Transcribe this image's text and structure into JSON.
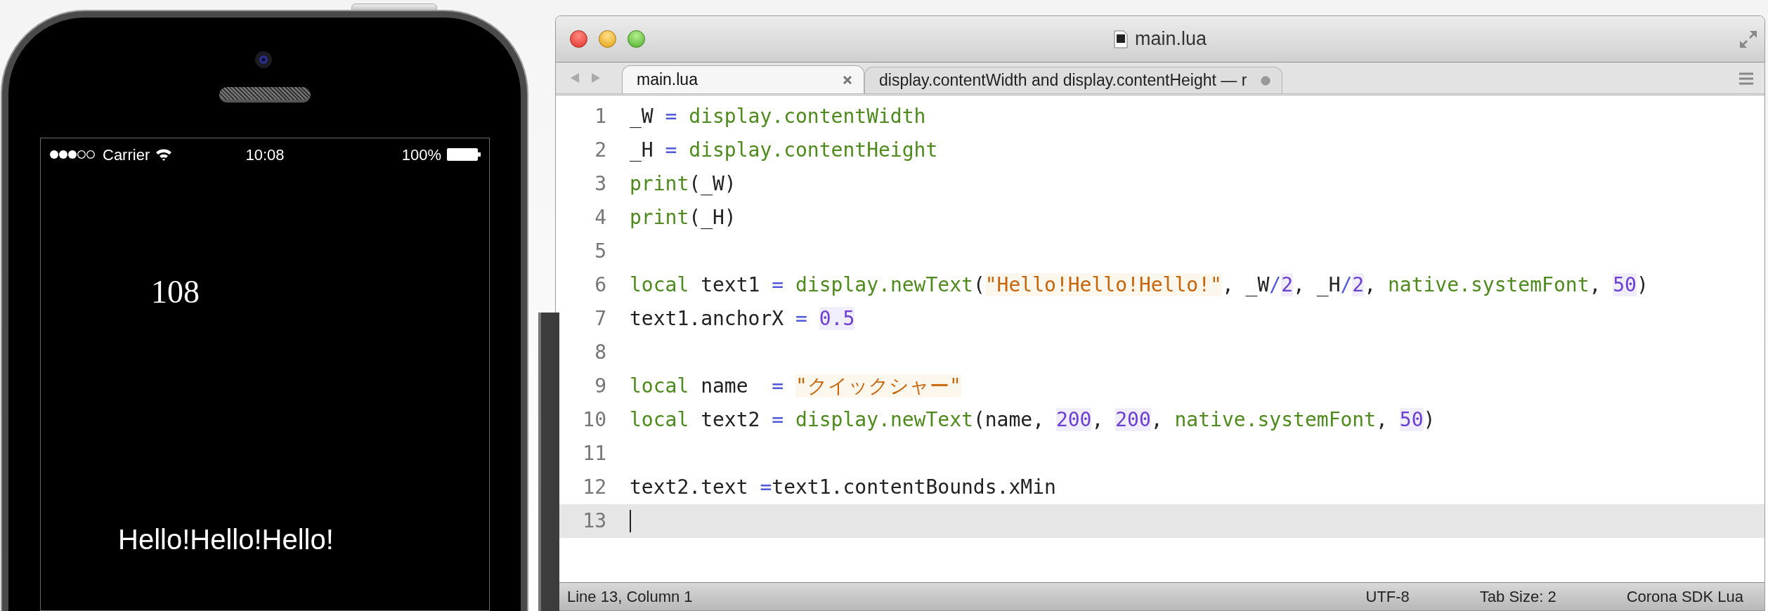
{
  "simulator": {
    "status_bar": {
      "carrier": "Carrier",
      "time": "10:08",
      "battery": "100%"
    },
    "screen": {
      "number_label": "108",
      "hello_label": "Hello!Hello!Hello!"
    }
  },
  "editor": {
    "window": {
      "title": "main.lua"
    },
    "tabs": [
      {
        "label": "main.lua",
        "selected": true,
        "modified": false
      },
      {
        "label": "display.contentWidth and display.contentHeight — r",
        "selected": false,
        "modified": true
      }
    ],
    "lines": [
      {
        "number": "1",
        "current": false,
        "tokens": [
          {
            "kind": "plain",
            "text": "_W "
          },
          {
            "kind": "operator",
            "text": "="
          },
          {
            "kind": "builtin",
            "text": " display.contentWidth"
          }
        ]
      },
      {
        "number": "2",
        "current": false,
        "tokens": [
          {
            "kind": "plain",
            "text": "_H "
          },
          {
            "kind": "operator",
            "text": "="
          },
          {
            "kind": "builtin",
            "text": " display.contentHeight"
          }
        ]
      },
      {
        "number": "3",
        "current": false,
        "tokens": [
          {
            "kind": "builtin",
            "text": "print"
          },
          {
            "kind": "plain",
            "text": "(_W)"
          }
        ]
      },
      {
        "number": "4",
        "current": false,
        "tokens": [
          {
            "kind": "builtin",
            "text": "print"
          },
          {
            "kind": "plain",
            "text": "(_H)"
          }
        ]
      },
      {
        "number": "5",
        "current": false
      },
      {
        "number": "6",
        "current": false,
        "tokens": [
          {
            "kind": "builtin",
            "text": "local"
          },
          {
            "kind": "plain",
            "text": " text1 "
          },
          {
            "kind": "operator",
            "text": "="
          },
          {
            "kind": "builtin",
            "text": " display.newText"
          },
          {
            "kind": "plain",
            "text": "("
          },
          {
            "kind": "string",
            "text": "\"Hello!Hello!Hello!\""
          },
          {
            "kind": "plain",
            "text": ", _W"
          },
          {
            "kind": "operator",
            "text": "/"
          },
          {
            "kind": "number",
            "text": "2"
          },
          {
            "kind": "plain",
            "text": ", _H"
          },
          {
            "kind": "operator",
            "text": "/"
          },
          {
            "kind": "number",
            "text": "2"
          },
          {
            "kind": "plain",
            "text": ", "
          },
          {
            "kind": "builtin",
            "text": "native.systemFont"
          },
          {
            "kind": "plain",
            "text": ", "
          },
          {
            "kind": "number",
            "text": "50"
          },
          {
            "kind": "plain",
            "text": ")"
          }
        ]
      },
      {
        "number": "7",
        "current": false,
        "tokens": [
          {
            "kind": "plain",
            "text": "text1.anchorX "
          },
          {
            "kind": "operator",
            "text": "= "
          },
          {
            "kind": "number",
            "text": "0.5"
          }
        ]
      },
      {
        "number": "8",
        "current": false
      },
      {
        "number": "9",
        "current": false,
        "tokens": [
          {
            "kind": "builtin",
            "text": "local"
          },
          {
            "kind": "plain",
            "text": " name  "
          },
          {
            "kind": "operator",
            "text": "= "
          },
          {
            "kind": "string",
            "text": "\"クイックシャー\""
          }
        ]
      },
      {
        "number": "10",
        "current": false,
        "tokens": [
          {
            "kind": "builtin",
            "text": "local"
          },
          {
            "kind": "plain",
            "text": " text2 "
          },
          {
            "kind": "operator",
            "text": "="
          },
          {
            "kind": "builtin",
            "text": " display.newText"
          },
          {
            "kind": "plain",
            "text": "(name, "
          },
          {
            "kind": "number",
            "text": "200"
          },
          {
            "kind": "plain",
            "text": ", "
          },
          {
            "kind": "number",
            "text": "200"
          },
          {
            "kind": "plain",
            "text": ", "
          },
          {
            "kind": "builtin",
            "text": "native.systemFont"
          },
          {
            "kind": "plain",
            "text": ", "
          },
          {
            "kind": "number",
            "text": "50"
          },
          {
            "kind": "plain",
            "text": ")"
          }
        ]
      },
      {
        "number": "11",
        "current": false
      },
      {
        "number": "12",
        "current": false,
        "tokens": [
          {
            "kind": "plain",
            "text": "text2.text "
          },
          {
            "kind": "operator",
            "text": "="
          },
          {
            "kind": "plain",
            "text": "text1.contentBounds.xMin"
          }
        ]
      },
      {
        "number": "13",
        "current": true
      }
    ],
    "status_bar": {
      "position": "Line 13, Column 1",
      "items": [
        "UTF-8",
        "Tab Size: 2",
        "Corona SDK Lua"
      ]
    }
  }
}
